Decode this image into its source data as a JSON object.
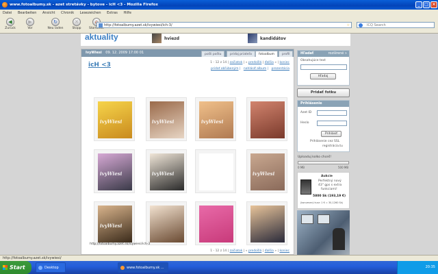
{
  "window": {
    "title": "www.fotoalbumy.sk - azet stretávky - bytove - icH <3 - Mozilla Firefox"
  },
  "menu": [
    "Datei",
    "Bearbeiten",
    "Ansicht",
    "Chronik",
    "Lesezeichen",
    "Extras",
    "Hilfe"
  ],
  "toolbar": {
    "back": "Zurück",
    "forward": "Vor",
    "reload": "Neu laden",
    "stop": "Stopp",
    "home": "Startseite",
    "url": "http://fotoalbumy.azet.sk/ivywiesi/ich-3/",
    "search_placeholder": "ICQ Search"
  },
  "banner": {
    "title": "aktuality",
    "item1": "hviezd",
    "item2": "kandidátov"
  },
  "album": {
    "user": "IvyWiesi",
    "date": "09. 12. 2009 17:00 01",
    "tabs": [
      "pošli poštu",
      "pridaj priateľa",
      "fotoalbum",
      "profil"
    ],
    "title": "icH <3",
    "pager": {
      "range": "1 - 12 z 14",
      "first": "začiatok",
      "prev": "predošlá",
      "next": "ďalšia",
      "last": "koniec"
    },
    "links": [
      "pridať obľúbeným",
      "nahlásiť album",
      "prezentácia"
    ],
    "url_text": "http://fotoalbumy.azet.sk/ivywiesi/ich-3"
  },
  "photos": [
    {
      "label": "ivyWiesi",
      "c1": "#f6d44a",
      "c2": "#c98a1e"
    },
    {
      "label": "ivyWiesi",
      "c1": "#9a6a4a",
      "c2": "#e7d5c4"
    },
    {
      "label": "ivyWiesi",
      "c1": "#f0c08a",
      "c2": "#b07a52"
    },
    {
      "label": "",
      "c1": "#d2846e",
      "c2": "#7a3a2c"
    },
    {
      "label": "ivyWiesi",
      "c1": "#d7a9d5",
      "c2": "#3a3a48"
    },
    {
      "label": "ivyWiesi",
      "c1": "#f0e6d8",
      "c2": "#2a2a2a"
    },
    {
      "label": "",
      "c1": "#ffffff",
      "c2": "#ffffff"
    },
    {
      "label": "ivyWiesi",
      "c1": "#c9a890",
      "c2": "#8a6a5a"
    },
    {
      "label": "ivyWiesi",
      "c1": "#d9b48c",
      "c2": "#3a2a1a"
    },
    {
      "label": "",
      "c1": "#f2e2d0",
      "c2": "#6a4a32"
    },
    {
      "label": "",
      "c1": "#e86aa8",
      "c2": "#c83a7a"
    },
    {
      "label": "",
      "c1": "#e8c49a",
      "c2": "#2a2a3a"
    }
  ],
  "sidebar": {
    "search": {
      "title": "Hľadať",
      "more": "rozšírené »",
      "label": "Obsahujúce text",
      "button": "Hľadaj"
    },
    "add_photo": "Pridať fotku",
    "login": {
      "title": "Prihlásenie",
      "id_label": "Azet ID",
      "pw_label": "Heslo",
      "button": "Prihlásiť",
      "ssl": "Prihlásenie cez SSL",
      "register": "registrácia.tu"
    },
    "upload": {
      "label": "Uploaduj kolko chceš!",
      "min": "0 MB",
      "max": "500 MB"
    },
    "ad": {
      "title": "Aukcie",
      "line1": "Perfektný nový",
      "line2": "43\" gps s extra",
      "line3": "funkciami!",
      "price": "5800 Sk (193,19 €)",
      "note": "(konverzný kurz: 1 € = 30,1260 Sk)"
    }
  },
  "status": "http://fotoalbumy.azet.sk/ivywiesi/",
  "taskbar": {
    "start": "Start",
    "task1": "Desktop",
    "task2": "www.fotoalbumy.sk ...",
    "clock": "20:35"
  }
}
